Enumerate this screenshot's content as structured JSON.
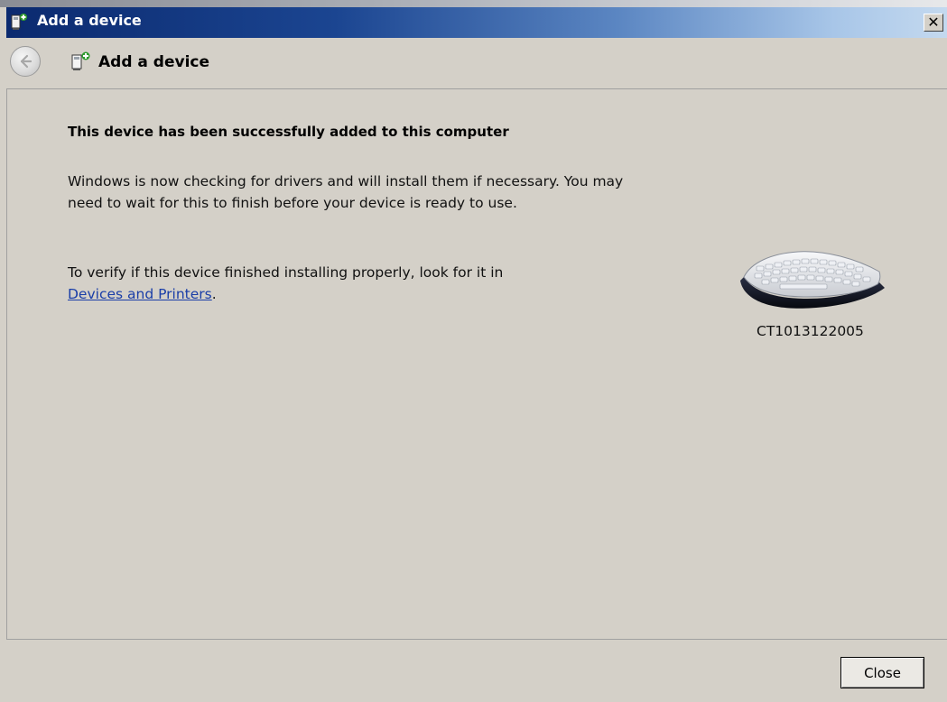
{
  "window": {
    "title": "Add a device",
    "close_glyph": "✕"
  },
  "nav": {
    "back_icon": "back-arrow-icon",
    "title": "Add a device"
  },
  "content": {
    "heading": "This device has been successfully added to this computer",
    "paragraph1": "Windows is now checking for drivers and will install them if necessary. You may need to wait for this to finish before your device is ready to use.",
    "paragraph2_text": "To verify if this device finished installing properly, look for it in",
    "paragraph2_link": "Devices and Printers",
    "paragraph2_end": "."
  },
  "device": {
    "icon": "keyboard-icon",
    "name": "CT1013122005"
  },
  "footer": {
    "close_label": "Close"
  },
  "colors": {
    "background": "#d4d0c8",
    "titlebar_start": "#0b2a6f",
    "titlebar_end": "#c4d9ef",
    "link": "#1a3ea8"
  }
}
